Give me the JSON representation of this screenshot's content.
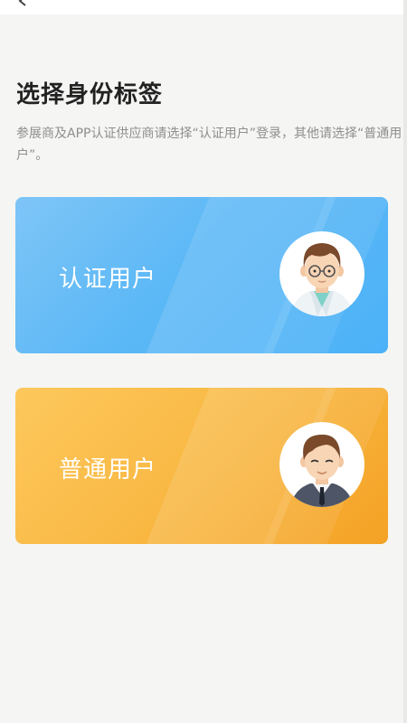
{
  "header": {
    "title": "选择身份标签",
    "description": "参展商及APP认证供应商请选择“认证用户”登录，其他请选择“普通用户”。"
  },
  "options": [
    {
      "label": "认证用户",
      "avatar": "doctor-avatar-icon",
      "color": "#5cb8f6"
    },
    {
      "label": "普通用户",
      "avatar": "businessman-avatar-icon",
      "color": "#f9b843"
    }
  ],
  "colors": {
    "background": "#f5f6f4",
    "title": "#222222",
    "description": "#8e8e8e"
  }
}
